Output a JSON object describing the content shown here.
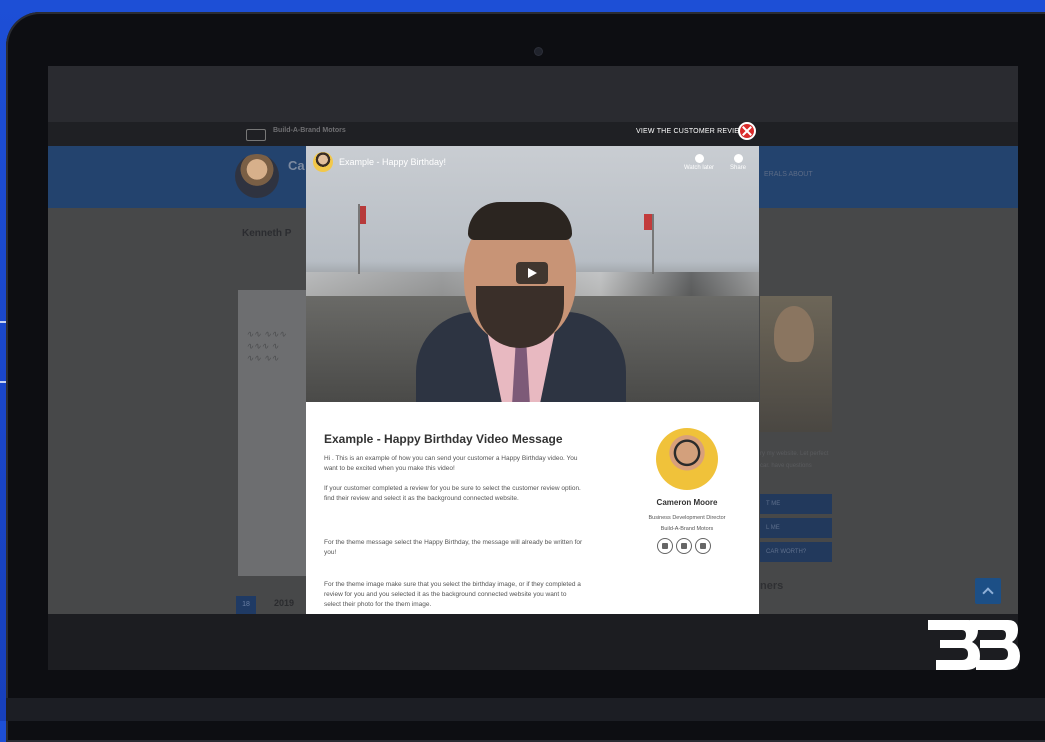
{
  "overlay": {
    "label": "VIEW THE CUSTOMER REVIEW",
    "close_icon": "close-icon"
  },
  "site_background": {
    "nav_brand": "Build-A-Brand Motors",
    "header_name_partial": "Ca",
    "body_name_partial": "Kenneth P",
    "right_links": "ERALS  ABOUT",
    "right_text_partial": "ry my website. Let perfect car. have questions",
    "buttons": [
      "T ME",
      "L ME",
      "CAR WORTH?"
    ],
    "bottom_badge": "18",
    "bottom_text_partial": "2019",
    "right_heading_partial": "ners"
  },
  "modal": {
    "video": {
      "title": "Example - Happy Birthday!",
      "watch_later": "Watch later",
      "share": "Share"
    },
    "content": {
      "title": "Example - Happy Birthday Video Message",
      "paragraphs": [
        "Hi . This is an example of how you can send your customer a Happy Birthday video. You want to be excited when you make this video!",
        "If your customer completed a review for you be sure to select the customer review option. find their review and select it as the background connected website.",
        "For the theme message select the Happy Birthday, the message will already be written for you!",
        "For the theme image make sure that you select the birthday image, or if they completed a review for you and you selected it as the background connected website you want to select their photo for the them image."
      ]
    },
    "profile": {
      "name": "Cameron Moore",
      "role": "Business Development Director",
      "company": "Build-A-Brand Motors",
      "contact_icons": [
        "phone-icon",
        "chat-icon",
        "email-icon"
      ]
    }
  },
  "colors": {
    "background_blue": "#1d4fd6",
    "close_red": "#d92b2b",
    "site_header_blue": "#23436e"
  }
}
